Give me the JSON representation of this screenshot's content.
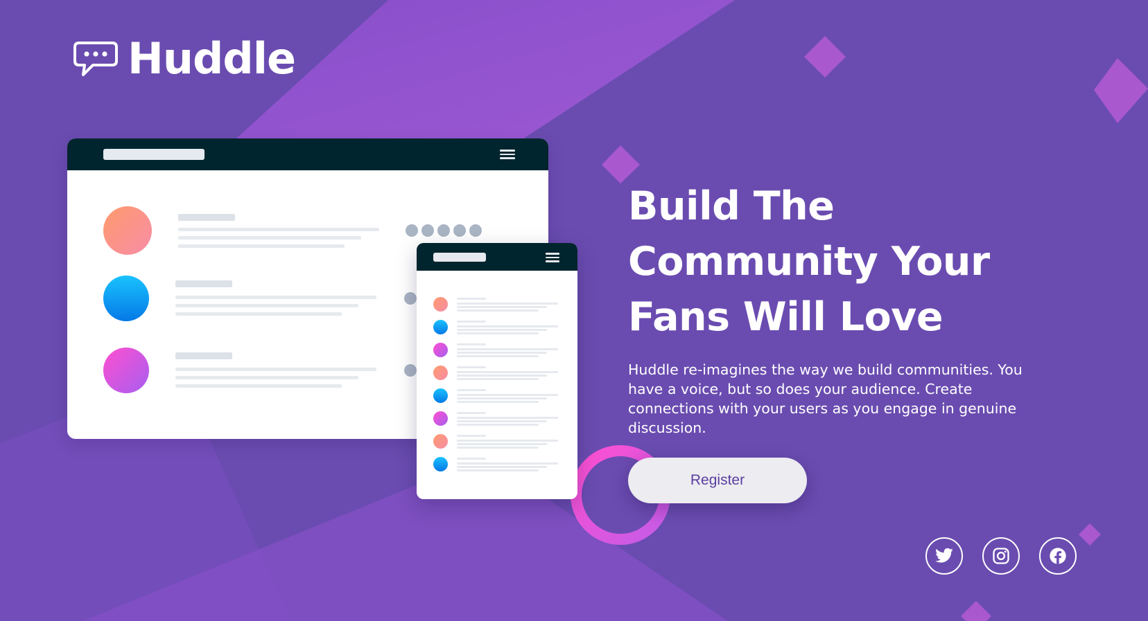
{
  "brand": {
    "name": "Huddle"
  },
  "hero": {
    "headline_lines": [
      "Build The",
      "Community Your",
      "Fans Will Love"
    ],
    "description": "Huddle re-imagines the way we build communities. You have a voice, but so does your audience. Create connections with your users as you engage in genuine discussion.",
    "register_label": "Register"
  },
  "socials": [
    {
      "name": "Twitter",
      "icon": "twitter-icon"
    },
    {
      "name": "Instagram",
      "icon": "instagram-icon"
    },
    {
      "name": "Facebook",
      "icon": "facebook-icon"
    }
  ],
  "colors": {
    "background": "#6a4cb0",
    "accent_pink": "#e85de6",
    "button_text": "#5c3e9e",
    "window_bar": "#00252e"
  }
}
